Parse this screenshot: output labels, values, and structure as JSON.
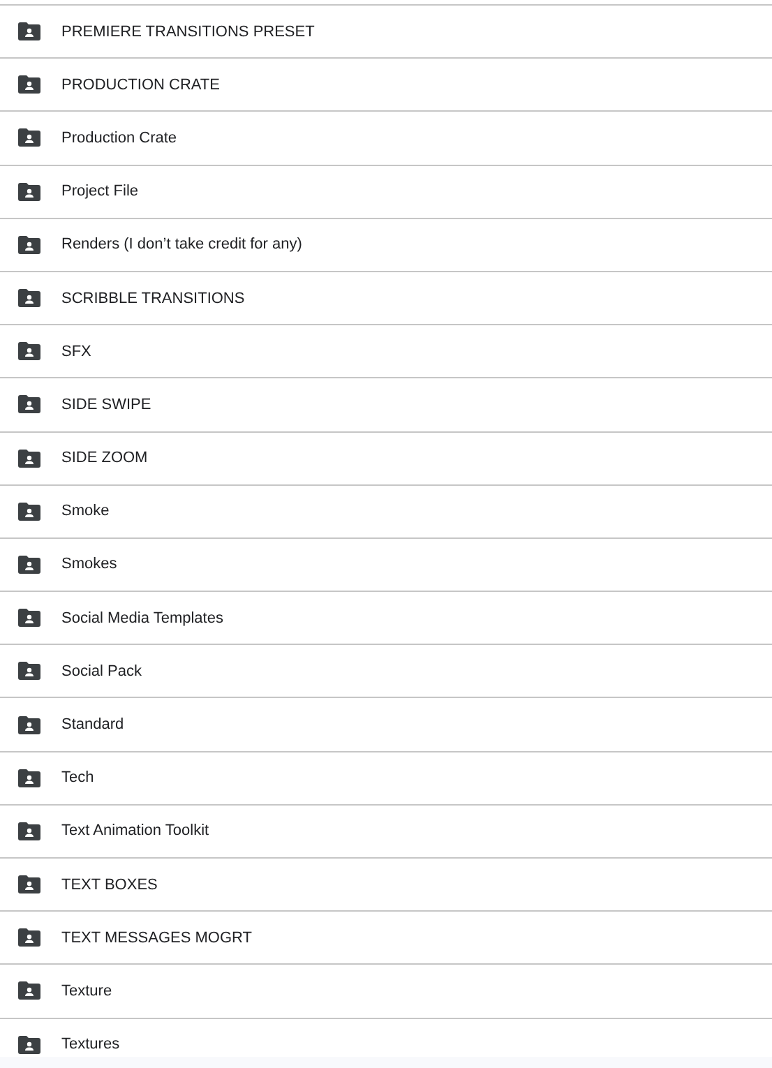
{
  "folders": [
    {
      "name": "PREMIERE TRANSITIONS PRESET"
    },
    {
      "name": "PRODUCTION CRATE"
    },
    {
      "name": "Production Crate"
    },
    {
      "name": "Project File"
    },
    {
      "name": "Renders (I don’t take credit for any)"
    },
    {
      "name": "SCRIBBLE TRANSITIONS"
    },
    {
      "name": "SFX"
    },
    {
      "name": "SIDE SWIPE"
    },
    {
      "name": "SIDE ZOOM"
    },
    {
      "name": "Smoke"
    },
    {
      "name": "Smokes"
    },
    {
      "name": "Social Media Templates"
    },
    {
      "name": "Social Pack"
    },
    {
      "name": "Standard"
    },
    {
      "name": "Tech"
    },
    {
      "name": "Text Animation Toolkit"
    },
    {
      "name": "TEXT BOXES"
    },
    {
      "name": "TEXT MESSAGES MOGRT"
    },
    {
      "name": "Texture"
    },
    {
      "name": "Textures"
    }
  ]
}
